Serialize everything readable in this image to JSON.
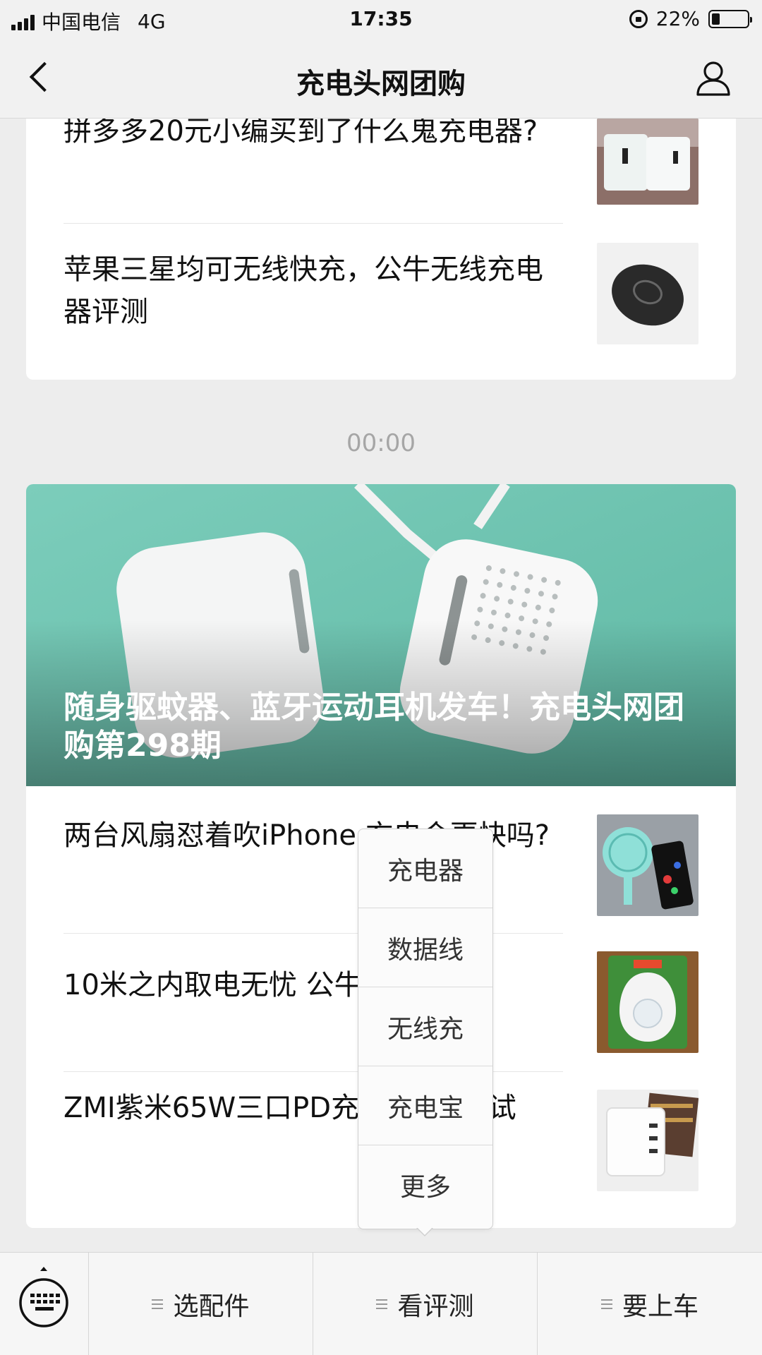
{
  "status_bar": {
    "carrier": "中国电信",
    "network": "4G",
    "time": "17:35",
    "battery_percent": "22%",
    "battery_level": 0.22
  },
  "nav": {
    "title": "充电头网团购",
    "back_icon": "chevron-left-icon",
    "profile_icon": "person-icon"
  },
  "top_card": {
    "articles": [
      {
        "title": "拼多多20元小编买到了什么鬼充电器?"
      },
      {
        "title": "苹果三星均可无线快充，公牛无线充电器评测"
      }
    ]
  },
  "timestamp": "00:00",
  "main_card": {
    "hero_title": "随身驱蚊器、蓝牙运动耳机发车！充电头网团购第298期",
    "articles": [
      {
        "title": "两台风扇怼着吹iPhone 充电会更快吗?"
      },
      {
        "title": "10米之内取电无忧 公牛 评测"
      },
      {
        "title": "ZMI紫米65W三口PD充 ne快充测试"
      }
    ]
  },
  "popup_menu": {
    "items": [
      "充电器",
      "数据线",
      "无线充",
      "充电宝",
      "更多"
    ]
  },
  "bottom_menu": {
    "keyboard_icon": "keyboard-icon",
    "items": [
      "选配件",
      "看评测",
      "要上车"
    ]
  },
  "colors": {
    "accent_hero": "#6cc3b0",
    "background": "#ededed"
  }
}
